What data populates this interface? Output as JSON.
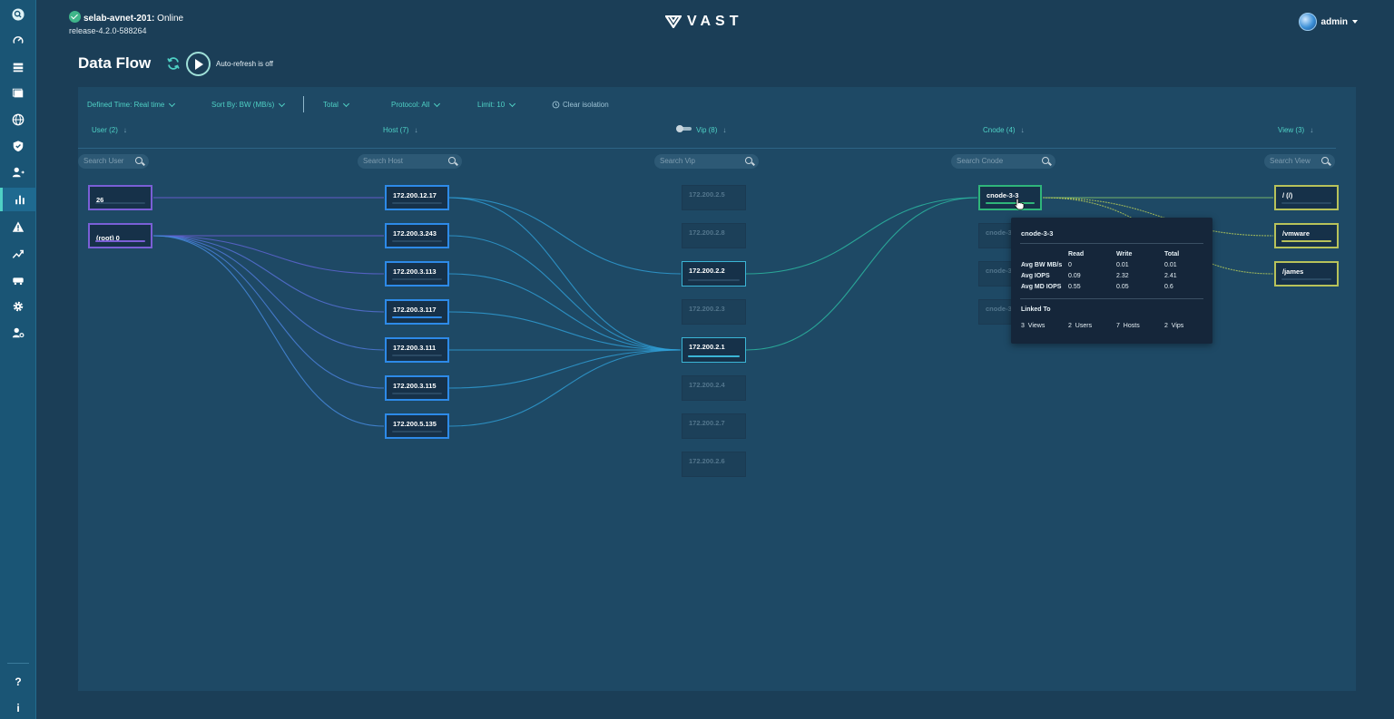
{
  "system": {
    "name": "selab-avnet-201",
    "status": "Online",
    "release": "release-4.2.0-588264"
  },
  "brand": "VAST",
  "user": {
    "name": "admin"
  },
  "page": {
    "title": "Data Flow",
    "auto_refresh": "Auto-refresh is off"
  },
  "filters": {
    "defined_time": "Defined Time: Real time",
    "sort_by": "Sort By:  BW (MB/s)",
    "total": "Total",
    "protocol": "Protocol:  All",
    "limit": "Limit:  10",
    "clear": "Clear isolation"
  },
  "columns": {
    "user": {
      "title": "User (2)",
      "search": "Search User"
    },
    "host": {
      "title": "Host (7)",
      "search": "Search Host"
    },
    "vip": {
      "title": "Vip (8)",
      "search": "Search Vip"
    },
    "cnode": {
      "title": "Cnode (4)",
      "search": "Search Cnode"
    },
    "view": {
      "title": "View (3)",
      "search": "Search View"
    }
  },
  "users": [
    {
      "label": "26",
      "fill": 0
    },
    {
      "label": "(root) 0",
      "fill": 1
    }
  ],
  "hosts": [
    {
      "label": "172.200.12.17",
      "fill": 0
    },
    {
      "label": "172.200.3.243",
      "fill": 0
    },
    {
      "label": "172.200.3.113",
      "fill": 0
    },
    {
      "label": "172.200.3.117",
      "fill": 1
    },
    {
      "label": "172.200.3.111",
      "fill": 0
    },
    {
      "label": "172.200.3.115",
      "fill": 0
    },
    {
      "label": "172.200.5.135",
      "fill": 0
    }
  ],
  "vips": [
    {
      "label": "172.200.2.5",
      "active": false
    },
    {
      "label": "172.200.2.8",
      "active": false
    },
    {
      "label": "172.200.2.2",
      "active": true
    },
    {
      "label": "172.200.2.3",
      "active": false
    },
    {
      "label": "172.200.2.1",
      "active": true
    },
    {
      "label": "172.200.2.4",
      "active": false
    },
    {
      "label": "172.200.2.7",
      "active": false
    },
    {
      "label": "172.200.2.6",
      "active": false
    }
  ],
  "cnodes": [
    {
      "label": "cnode-3-3",
      "active": true
    },
    {
      "label": "cnode-3",
      "active": false
    },
    {
      "label": "cnode-3",
      "active": false
    },
    {
      "label": "cnode-3",
      "active": false
    }
  ],
  "views": [
    {
      "label": "/ (/)",
      "fill": 0
    },
    {
      "label": "/vmware",
      "fill": 1
    },
    {
      "label": "/james",
      "fill": 0
    }
  ],
  "tooltip": {
    "title": "cnode-3-3",
    "headers": [
      "Read",
      "Write",
      "Total"
    ],
    "rows": [
      {
        "label": "Avg BW MB/s",
        "values": [
          "0",
          "0.01",
          "0.01"
        ]
      },
      {
        "label": "Avg IOPS",
        "values": [
          "0.09",
          "2.32",
          "2.41"
        ]
      },
      {
        "label": "Avg MD IOPS",
        "values": [
          "0.55",
          "0.05",
          "0.6"
        ]
      }
    ],
    "linked_title": "Linked To",
    "linked": [
      {
        "count": "3",
        "label": "Views"
      },
      {
        "count": "2",
        "label": "Users"
      },
      {
        "count": "7",
        "label": "Hosts"
      },
      {
        "count": "2",
        "label": "Vips"
      }
    ]
  },
  "colors": {
    "accent": "#4fd1c5",
    "user": "#7a5fd6",
    "host": "#2d8ae8",
    "vip": "#3bb5d6",
    "cnode": "#2fb57a",
    "view": "#b8c25a"
  },
  "rail_icons": [
    "search-icon",
    "dashboard-icon",
    "capacity-icon",
    "elements-icon",
    "network-icon",
    "security-icon",
    "user-management-icon",
    "analytics-icon",
    "alerts-icon",
    "trends-icon",
    "hardware-icon",
    "settings-icon",
    "admin-settings-icon",
    "help-icon",
    "info-icon"
  ],
  "rail_glyphs": {
    "help": "?",
    "info": "i"
  }
}
